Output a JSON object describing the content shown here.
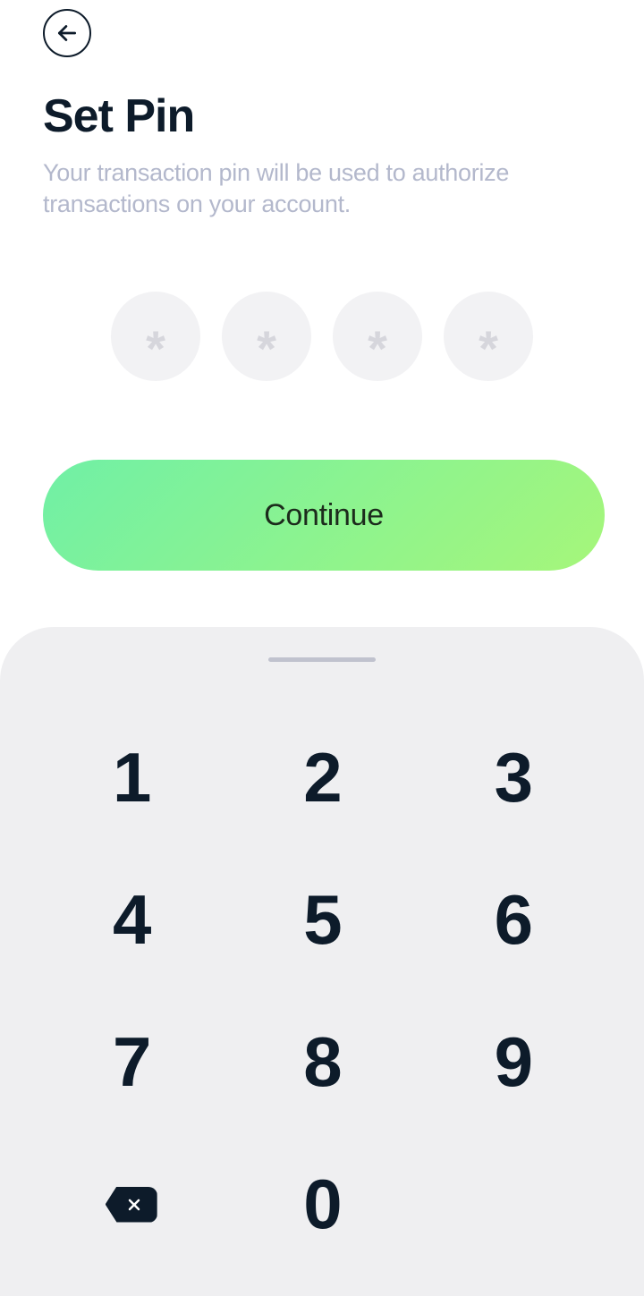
{
  "header": {
    "title": "Set Pin",
    "subtitle": "Your transaction pin will be used to authorize transactions on your account."
  },
  "pin": {
    "placeholder": "*",
    "slots": [
      "",
      "",
      "",
      ""
    ]
  },
  "actions": {
    "continue_label": "Continue"
  },
  "keypad": {
    "keys": [
      "1",
      "2",
      "3",
      "4",
      "5",
      "6",
      "7",
      "8",
      "9",
      "0"
    ]
  }
}
